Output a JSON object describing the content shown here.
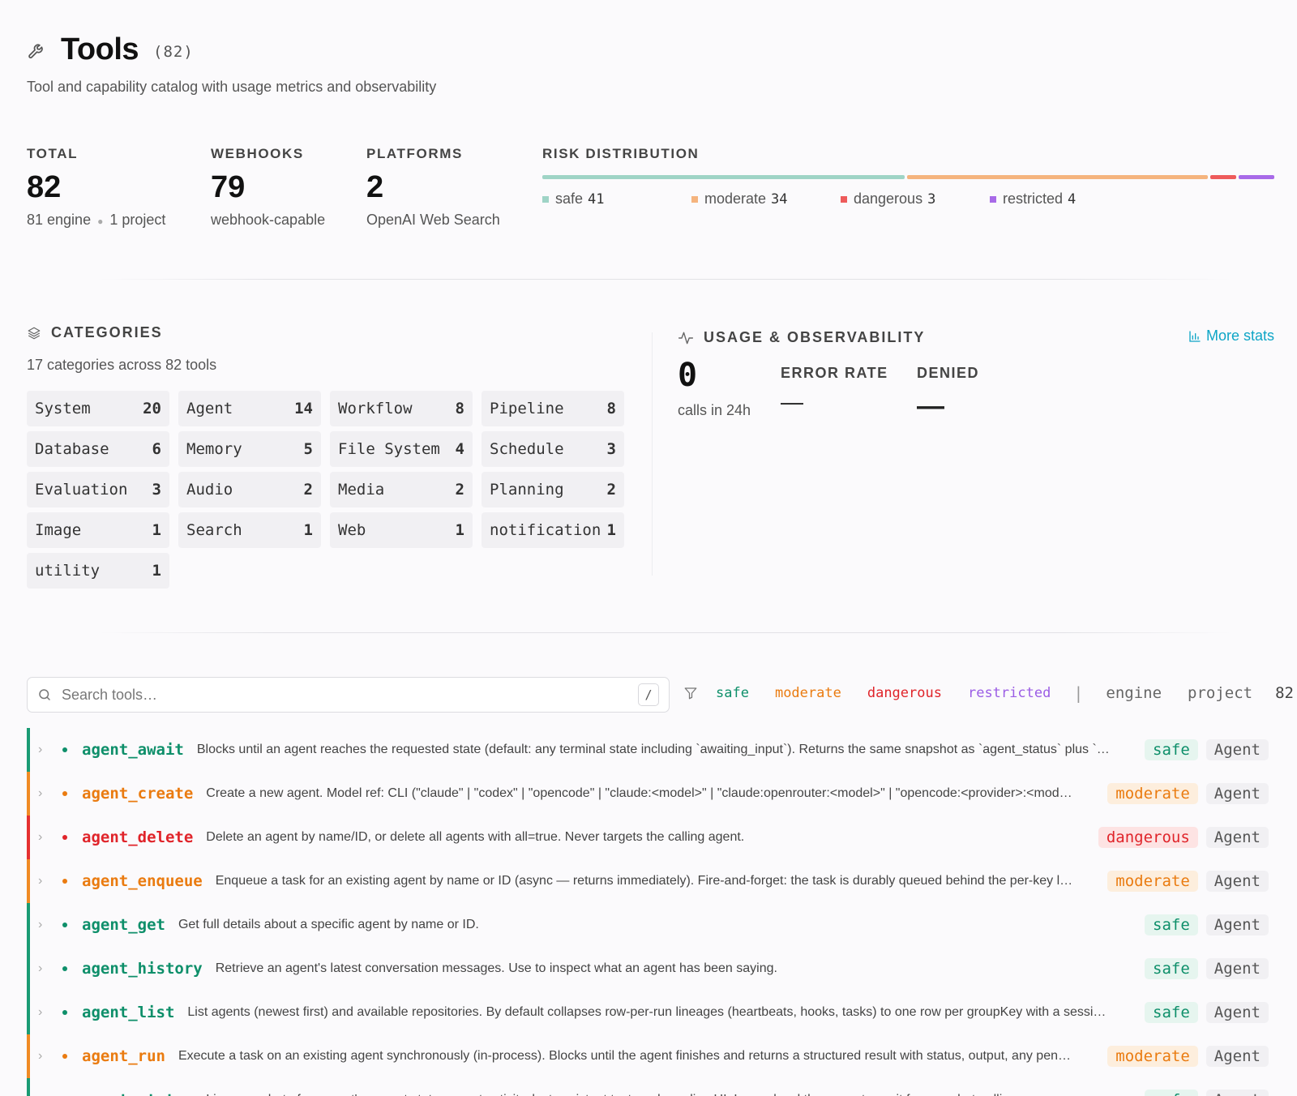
{
  "header": {
    "title": "Tools",
    "count": "(82)",
    "subtitle": "Tool and capability catalog with usage metrics and observability"
  },
  "stats": {
    "total": {
      "label": "TOTAL",
      "value": "82",
      "engine": "81 engine",
      "project": "1 project"
    },
    "webhooks": {
      "label": "WEBHOOKS",
      "value": "79",
      "sub": "webhook-capable"
    },
    "platforms": {
      "label": "PLATFORMS",
      "value": "2",
      "sub": "OpenAI Web Search"
    }
  },
  "risk_distribution": {
    "label": "RISK DISTRIBUTION",
    "items": [
      {
        "name": "safe",
        "count": 41,
        "color": "#9fd4c6"
      },
      {
        "name": "moderate",
        "count": 34,
        "color": "#f5b47e"
      },
      {
        "name": "dangerous",
        "count": 3,
        "color": "#ee5b5b"
      },
      {
        "name": "restricted",
        "count": 4,
        "color": "#a86ae8"
      }
    ]
  },
  "categories": {
    "title": "CATEGORIES",
    "subtitle": "17 categories across 82 tools",
    "items": [
      {
        "name": "System",
        "count": "20"
      },
      {
        "name": "Agent",
        "count": "14"
      },
      {
        "name": "Workflow",
        "count": "8"
      },
      {
        "name": "Pipeline",
        "count": "8"
      },
      {
        "name": "Database",
        "count": "6"
      },
      {
        "name": "Memory",
        "count": "5"
      },
      {
        "name": "File System",
        "count": "4"
      },
      {
        "name": "Schedule",
        "count": "3"
      },
      {
        "name": "Evaluation",
        "count": "3"
      },
      {
        "name": "Audio",
        "count": "2"
      },
      {
        "name": "Media",
        "count": "2"
      },
      {
        "name": "Planning",
        "count": "2"
      },
      {
        "name": "Image",
        "count": "1"
      },
      {
        "name": "Search",
        "count": "1"
      },
      {
        "name": "Web",
        "count": "1"
      },
      {
        "name": "notification",
        "count": "1"
      },
      {
        "name": "utility",
        "count": "1"
      }
    ]
  },
  "usage": {
    "title": "USAGE & OBSERVABILITY",
    "more_stats": "More stats",
    "calls_value": "0",
    "calls_label": "calls in 24h",
    "error_rate_label": "ERROR RATE",
    "error_rate_value": "—",
    "denied_label": "DENIED",
    "denied_value": "—"
  },
  "filter": {
    "search_placeholder": "Search tools…",
    "shortcut": "/",
    "risk_filters": [
      "safe",
      "moderate",
      "dangerous",
      "restricted"
    ],
    "separator": "|",
    "source_filters": [
      "engine",
      "project"
    ],
    "count": "82"
  },
  "colors": {
    "safe": {
      "text": "#0e8f6a",
      "bg": "#e6f5ef",
      "border": "#1a9b74"
    },
    "moderate": {
      "text": "#ea7b10",
      "bg": "#fdeedd",
      "border": "#f08a24"
    },
    "dangerous": {
      "text": "#e0242a",
      "bg": "#fde3e3",
      "border": "#e53030"
    },
    "restricted": {
      "text": "#9b5de5",
      "bg": "#f1e7fc",
      "border": "#a86ae8"
    }
  },
  "tools": [
    {
      "name": "agent_await",
      "risk": "safe",
      "category": "Agent",
      "description": "Blocks until an agent reaches the requested state (default: any terminal state including `awaiting_input`). Returns the same snapshot as `agent_status` plus `…"
    },
    {
      "name": "agent_create",
      "risk": "moderate",
      "category": "Agent",
      "description": "Create a new agent. Model ref: CLI (\"claude\" | \"codex\" | \"opencode\" | \"claude:<model>\" | \"claude:openrouter:<model>\" | \"opencode:<provider>:<mod…"
    },
    {
      "name": "agent_delete",
      "risk": "dangerous",
      "category": "Agent",
      "description": "Delete an agent by name/ID, or delete all agents with all=true. Never targets the calling agent."
    },
    {
      "name": "agent_enqueue",
      "risk": "moderate",
      "category": "Agent",
      "description": "Enqueue a task for an existing agent by name or ID (async — returns immediately). Fire-and-forget: the task is durably queued behind the per-key l…"
    },
    {
      "name": "agent_get",
      "risk": "safe",
      "category": "Agent",
      "description": "Get full details about a specific agent by name or ID."
    },
    {
      "name": "agent_history",
      "risk": "safe",
      "category": "Agent",
      "description": "Retrieve an agent's latest conversation messages. Use to inspect what an agent has been saying."
    },
    {
      "name": "agent_list",
      "risk": "safe",
      "category": "Agent",
      "description": "List agents (newest first) and available repositories. By default collapses row-per-run lineages (heartbeats, hooks, tasks) to one row per groupKey with a sessi…"
    },
    {
      "name": "agent_run",
      "risk": "moderate",
      "category": "Agent",
      "description": "Execute a task on an existing agent synchronously (in-process). Blocks until the agent finishes and returns a structured result with status, output, any pen…"
    },
    {
      "name": "agent_status",
      "risk": "safe",
      "category": "Agent",
      "description": "Live snapshot of an agent's current state, recent activity, last assistant text, and pending UI. Lower-level than agent_await for one-shot polling…"
    }
  ]
}
